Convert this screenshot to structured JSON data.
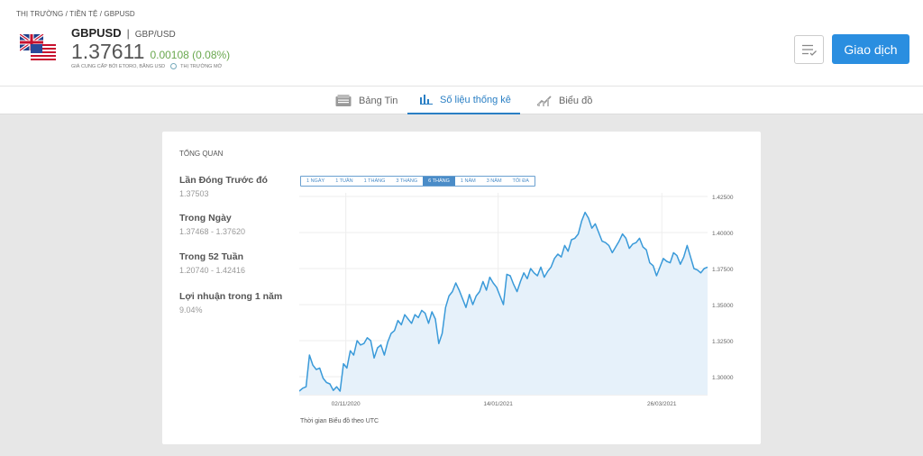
{
  "breadcrumb": {
    "item1": "THỊ TRƯỜNG",
    "sep": "/",
    "item2": "TIỀN TỆ",
    "item3": "GBPUSD"
  },
  "instrument": {
    "symbol": "GBPUSD",
    "separator": "|",
    "pair_name": "GBP/USD",
    "price": "1.37611",
    "change": "0.00108 (0.08%)",
    "subtitle": "GIÁ CUNG CẤP BỞI ETORO, BẰNG USD",
    "market_status": "THỊ TRƯỜNG MỞ"
  },
  "actions": {
    "trade_label": "Giao dịch"
  },
  "tabs": [
    {
      "label": "Bảng Tin",
      "icon": "news-icon"
    },
    {
      "label": "Số liệu thống kê",
      "icon": "bar-chart-icon"
    },
    {
      "label": "Biểu đồ",
      "icon": "chart-icon"
    }
  ],
  "overview": {
    "title": "TỔNG QUAN",
    "stats": [
      {
        "label": "Lần Đóng Trước đó",
        "value": "1.37503"
      },
      {
        "label": "Trong Ngày",
        "value": "1.37468 - 1.37620"
      },
      {
        "label": "Trong 52 Tuần",
        "value": "1.20740 - 1.42416"
      },
      {
        "label": "Lợi nhuận trong 1 năm",
        "value": "9.04%"
      }
    ],
    "ranges": [
      "1 NGÀY",
      "1 TUẦN",
      "1 THÁNG",
      "3 THÁNG",
      "6 THÁNG",
      "1 NĂM",
      "3 NĂM",
      "TỐI ĐA"
    ],
    "selected_range": "6 THÁNG",
    "footnote": "Thời gian Biểu đồ theo UTC"
  },
  "colors": {
    "accent": "#2a8ee0",
    "positive": "#6aa84f",
    "line": "#3a9ad9",
    "fill": "#e6f1fa"
  },
  "chart_data": {
    "type": "area",
    "x_ticks": [
      "02/11/2020",
      "14/01/2021",
      "26/03/2021"
    ],
    "y_ticks": [
      "1.42500",
      "1.40000",
      "1.37500",
      "1.35000",
      "1.32500",
      "1.30000"
    ],
    "ylim": [
      1.2875,
      1.4275
    ],
    "grid": true,
    "values": [
      1.29,
      1.292,
      1.293,
      1.315,
      1.308,
      1.305,
      1.306,
      1.299,
      1.296,
      1.295,
      1.2905,
      1.293,
      1.29,
      1.309,
      1.306,
      1.318,
      1.315,
      1.325,
      1.322,
      1.323,
      1.327,
      1.325,
      1.313,
      1.32,
      1.322,
      1.315,
      1.324,
      1.33,
      1.332,
      1.339,
      1.336,
      1.343,
      1.34,
      1.337,
      1.343,
      1.341,
      1.346,
      1.344,
      1.337,
      1.345,
      1.34,
      1.323,
      1.33,
      1.348,
      1.356,
      1.359,
      1.365,
      1.36,
      1.354,
      1.348,
      1.357,
      1.35,
      1.356,
      1.359,
      1.366,
      1.36,
      1.369,
      1.365,
      1.362,
      1.356,
      1.35,
      1.371,
      1.37,
      1.364,
      1.359,
      1.366,
      1.372,
      1.368,
      1.375,
      1.372,
      1.37,
      1.376,
      1.369,
      1.373,
      1.376,
      1.382,
      1.385,
      1.383,
      1.391,
      1.387,
      1.395,
      1.396,
      1.399,
      1.408,
      1.414,
      1.41,
      1.403,
      1.406,
      1.4,
      1.394,
      1.393,
      1.391,
      1.386,
      1.39,
      1.394,
      1.399,
      1.396,
      1.389,
      1.392,
      1.393,
      1.396,
      1.39,
      1.388,
      1.379,
      1.377,
      1.37,
      1.376,
      1.382,
      1.38,
      1.379,
      1.386,
      1.384,
      1.378,
      1.383,
      1.391,
      1.383,
      1.375,
      1.374,
      1.372,
      1.375,
      1.376
    ]
  }
}
